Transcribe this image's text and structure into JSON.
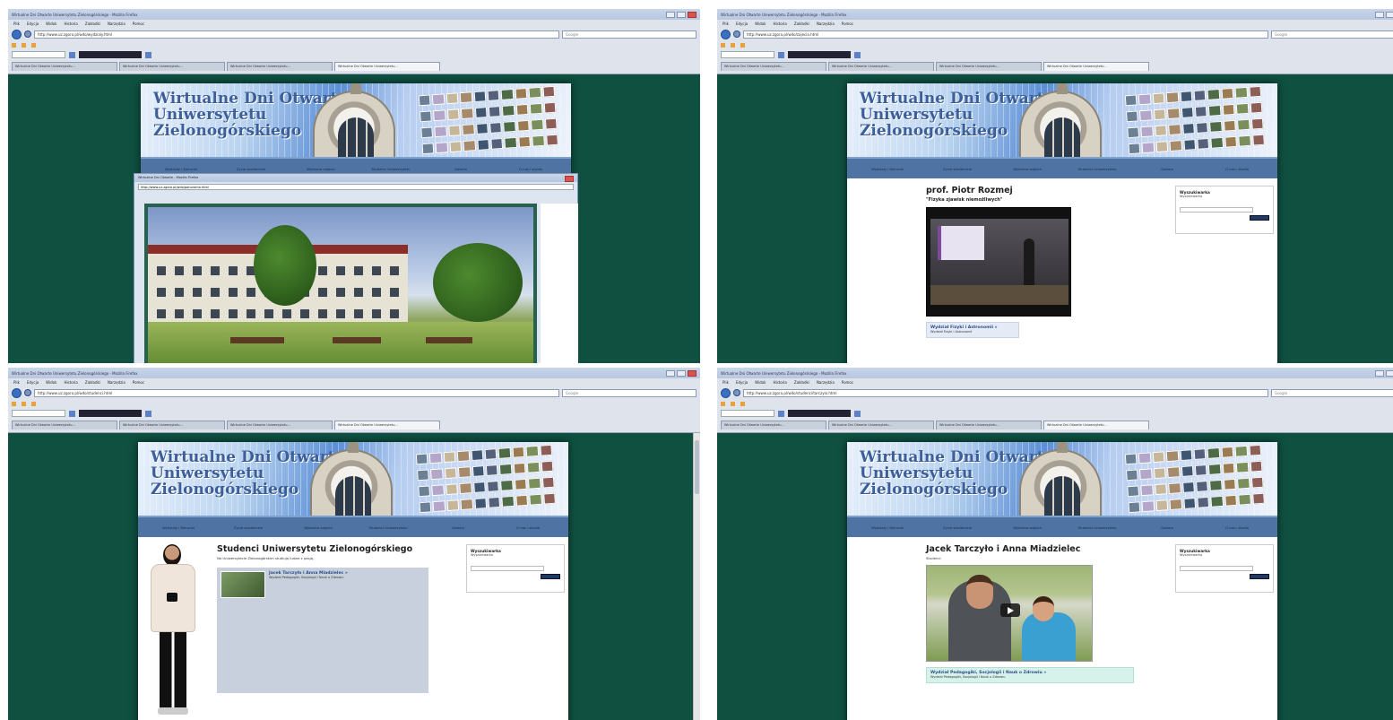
{
  "site": {
    "title_line1": "Wirtualne Dni Otwarte",
    "title_line2": "Uniwersytetu",
    "title_line3": "Zielonogórskiego",
    "menu": [
      "Wydziały i Kierunki",
      "Życie studenckie",
      "Wybrane zajęcia",
      "Studenci Uniwersytetu",
      "Galeria",
      "O nas i studia"
    ]
  },
  "browser": {
    "menubar": [
      "Plik",
      "Edycja",
      "Widok",
      "Historia",
      "Zakładki",
      "Narzędzia",
      "Pomoc"
    ],
    "search_placeholder": "Google"
  },
  "panels": [
    {
      "window_title": "Wirtualne Dni Otwarte Uniwersytetu Zielonogórskiego - Mozilla Firefox",
      "url": "http://www.uz.zgora.pl/wdo/wydzialy.html",
      "popup_title": "Wirtualne Dni Otwarte - Mozilla Firefox",
      "popup_url": "http://www.uz.zgora.pl/wdo/panorama.html"
    },
    {
      "window_title": "Wirtualne Dni Otwarte Uniwersytetu Zielonogórskiego - Mozilla Firefox",
      "url": "http://www.uz.zgora.pl/wdo/zajecia.html",
      "heading": "prof. Piotr Rozmej",
      "subheading": "\"Fizyka zjawisk niemożliwych\"",
      "faculty_title": "Wydział Fizyki i Astronomii »",
      "faculty_desc": "Wydział Fizyki i Astronomii"
    },
    {
      "window_title": "Wirtualne Dni Otwarte Uniwersytetu Zielonogórskiego - Mozilla Firefox",
      "url": "http://www.uz.zgora.pl/wdo/studenci.html",
      "heading": "Studenci Uniwersytetu Zielonogórskiego",
      "desc": "Na Uniwersytecie Zielonogórskim studiują ludzie z pasją.",
      "card_title": "Jacek Tarczyło i Anna Miadzielec »",
      "card_desc": "Wydział Pedagogiki, Socjologii i Nauk o Zdrowiu"
    },
    {
      "window_title": "Wirtualne Dni Otwarte Uniwersytetu Zielonogórskiego - Mozilla Firefox",
      "url": "http://www.uz.zgora.pl/wdo/studenci/tarczylo.html",
      "heading": "Jacek Tarczyło i Anna Miadzielec",
      "desc": "Studenci",
      "faculty_title": "Wydział Pedagogiki, Socjologii i Nauk o Zdrowiu »",
      "faculty_desc": "Wydział Pedagogiki, Socjologii i Nauk o Zdrowiu"
    }
  ],
  "sidebar": {
    "title": "Wyszukiwarka",
    "desc": "Wyszukiwarka"
  },
  "tabs": [
    "Wirtualne Dni Otwarte Uniwersytetu...",
    "Wirtualne Dni Otwarte Uniwersytetu...",
    "Wirtualne Dni Otwarte Uniwersytetu...",
    "Wirtualne Dni Otwarte Uniwersytetu..."
  ],
  "colors": {
    "page_bg": "#0f5040",
    "menu_bg": "#4f74a4",
    "accent": "#3a6fc4"
  }
}
